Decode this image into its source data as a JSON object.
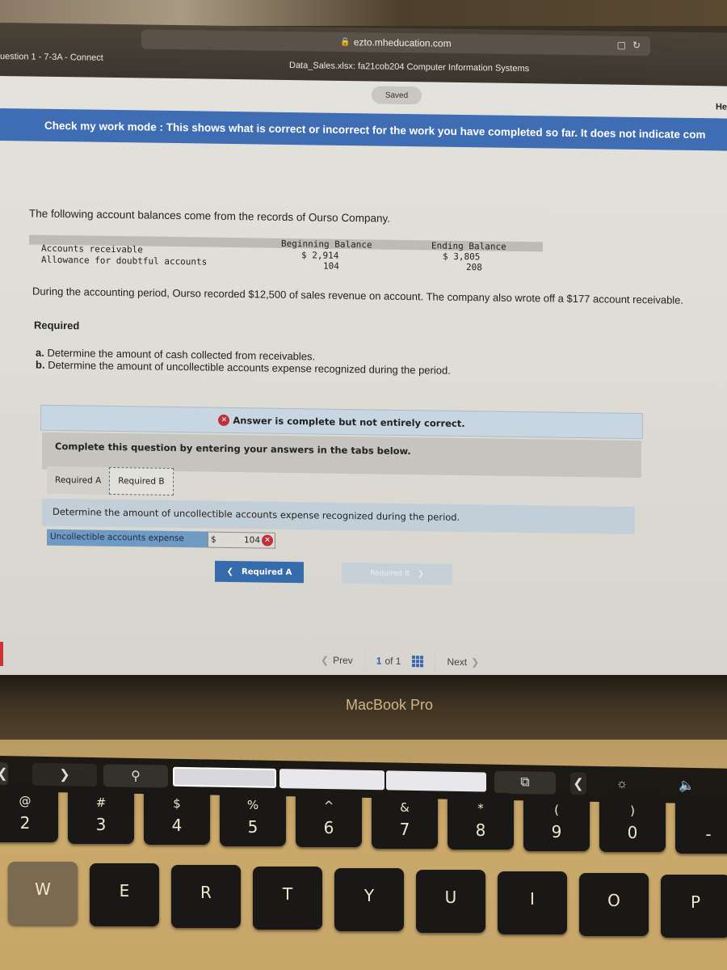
{
  "browser": {
    "url": "ezto.mheducation.com",
    "tab_left": "uestion 1 - 7-3A - Connect",
    "tab_center": "Data_Sales.xlsx: fa21cob204 Computer Information Systems"
  },
  "page": {
    "saved_label": "Saved",
    "help_label": "He",
    "check_banner": "Check my work mode : This shows what is correct or incorrect for the work you have completed so far. It does not indicate com",
    "intro": "The following account balances come from the records of Ourso Company.",
    "balances": {
      "headers": [
        "Beginning Balance",
        "Ending Balance"
      ],
      "rows": [
        {
          "label": "Accounts receivable",
          "beginning": "$ 2,914",
          "ending": "$ 3,805"
        },
        {
          "label": "Allowance for doubtful accounts",
          "beginning": "104",
          "ending": "208"
        }
      ]
    },
    "paragraph": "During the accounting period, Ourso recorded $12,500 of sales revenue on account. The company also wrote off a $177 account receivable.",
    "required_heading": "Required",
    "requirements": [
      {
        "letter": "a.",
        "text": "Determine the amount of cash collected from receivables."
      },
      {
        "letter": "b.",
        "text": "Determine the amount of uncollectible accounts expense recognized during the period."
      }
    ],
    "answer_status": "Answer is complete but not entirely correct.",
    "complete_instruction": "Complete this question by entering your answers in the tabs below.",
    "tabs": [
      {
        "label": "Required A",
        "active": false
      },
      {
        "label": "Required B",
        "active": true
      }
    ],
    "tab_prompt": "Determine the amount of uncollectible accounts expense recognized during the period.",
    "answer_row": {
      "label": "Uncollectible accounts expense",
      "currency": "$",
      "value": "104",
      "status": "incorrect"
    },
    "prev_req_button": "Required A",
    "next_req_button": "Required B",
    "pager": {
      "prev": "Prev",
      "current": "1",
      "of_text": "of 1",
      "next": "Next"
    }
  },
  "device": {
    "label": "MacBook Pro",
    "number_keys": [
      {
        "sym": "@",
        "main": "2"
      },
      {
        "sym": "#",
        "main": "3"
      },
      {
        "sym": "$",
        "main": "4"
      },
      {
        "sym": "%",
        "main": "5"
      },
      {
        "sym": "^",
        "main": "6"
      },
      {
        "sym": "&",
        "main": "7"
      },
      {
        "sym": "*",
        "main": "8"
      },
      {
        "sym": "(",
        "main": "9"
      },
      {
        "sym": ")",
        "main": "0"
      },
      {
        "sym": "",
        "main": "-"
      }
    ],
    "letter_keys": [
      "W",
      "E",
      "R",
      "T",
      "Y",
      "U",
      "I",
      "O",
      "P"
    ]
  },
  "colors": {
    "banner_blue": "#3f6db3",
    "error_red": "#c0303a",
    "button_blue": "#356aac"
  }
}
